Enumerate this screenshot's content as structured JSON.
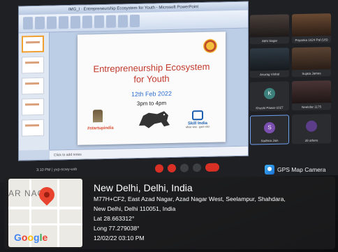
{
  "window": {
    "title": "IMG_I · Entrepreneurship Ecosystem for Youth - Microsoft PowerPoint"
  },
  "slide": {
    "title_line1": "Entrepreneurship Ecosystem",
    "title_line2": "for Youth",
    "date": "12th Feb 2022",
    "time": "3pm to 4pm",
    "logo_startup": "#startupindia",
    "logo_skill": "Skill India",
    "logo_skill_sub": "कौशल भारत · कुशल भारत"
  },
  "notes_placeholder": "Click to add notes",
  "participants": [
    {
      "name": "Abhi Sagar",
      "initial": "",
      "color": "#2b2c30"
    },
    {
      "name": "Priyanka 1024 Pal (US)",
      "initial": "",
      "color": "#7a4a2a"
    },
    {
      "name": "Anurag Vishal",
      "initial": "",
      "color": "#2b2c30"
    },
    {
      "name": "Sujata James",
      "initial": "",
      "color": "#5a4a3a"
    },
    {
      "name": "Khushi Pawar-1027",
      "initial": "K",
      "color": "#3d7f7a"
    },
    {
      "name": "Neelofar 1175",
      "initial": "",
      "color": "#4a3a3a"
    },
    {
      "name": "Sadhna Jain",
      "initial": "S",
      "color": "#7b4fb0"
    },
    {
      "name": "39 others",
      "initial": "",
      "color": "#2b2c30"
    }
  ],
  "toolbar": {
    "time_meeting": "3:10 PM | yvp-scwy-usb"
  },
  "gps_badge": {
    "label": "GPS Map Camera"
  },
  "map": {
    "area_label": "AR NAG",
    "brand": "Google"
  },
  "location": {
    "city": "New Delhi, Delhi, India",
    "address_line1": "M77H+CF2, East Azad Nagar, Azad Nagar West, Seelampur, Shahdara,",
    "address_line2": "New Delhi, Delhi 110051, India",
    "lat": "Lat 28.663312°",
    "long": "Long 77.279038°",
    "datetime": "12/02/22 03:10 PM"
  }
}
